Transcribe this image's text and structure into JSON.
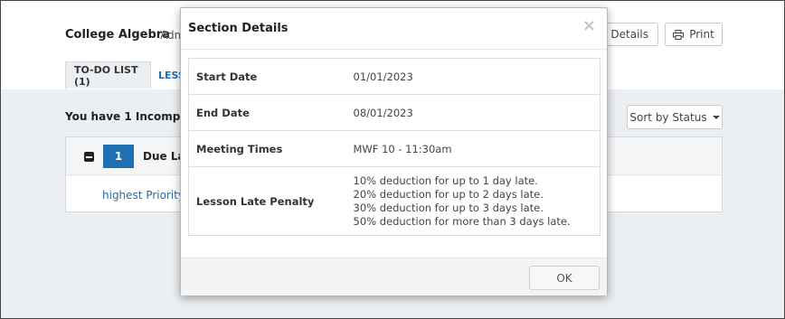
{
  "header": {
    "course_title": "College Algebra",
    "course_sub": "Adm",
    "details_button": "n Details",
    "print_button": "Print"
  },
  "tabs": [
    {
      "label": "TO-DO LIST (1)",
      "active": true
    },
    {
      "label": "LESS",
      "active": false
    }
  ],
  "todo": {
    "incomplete_text": "You have 1 Incomplete",
    "sort_label": "Sort by Status",
    "group": {
      "count": "1",
      "label": "Due Lat",
      "link": "highest Priority"
    }
  },
  "modal": {
    "title": "Section Details",
    "close_glyph": "×",
    "rows": [
      {
        "label": "Start Date",
        "value": "01/01/2023"
      },
      {
        "label": "End Date",
        "value": "08/01/2023"
      },
      {
        "label": "Meeting Times",
        "value": "MWF 10 - 11:30am"
      }
    ],
    "penalty": {
      "label": "Lesson Late Penalty",
      "lines": [
        "10% deduction for up to 1 day late.",
        "20% deduction for up to 2 days late.",
        "30% deduction for up to 3 days late.",
        "50% deduction for more than 3 days late."
      ]
    },
    "ok_button": "OK"
  },
  "colors": {
    "accent": "#1f6fb2",
    "page_gray": "#eceff2"
  }
}
